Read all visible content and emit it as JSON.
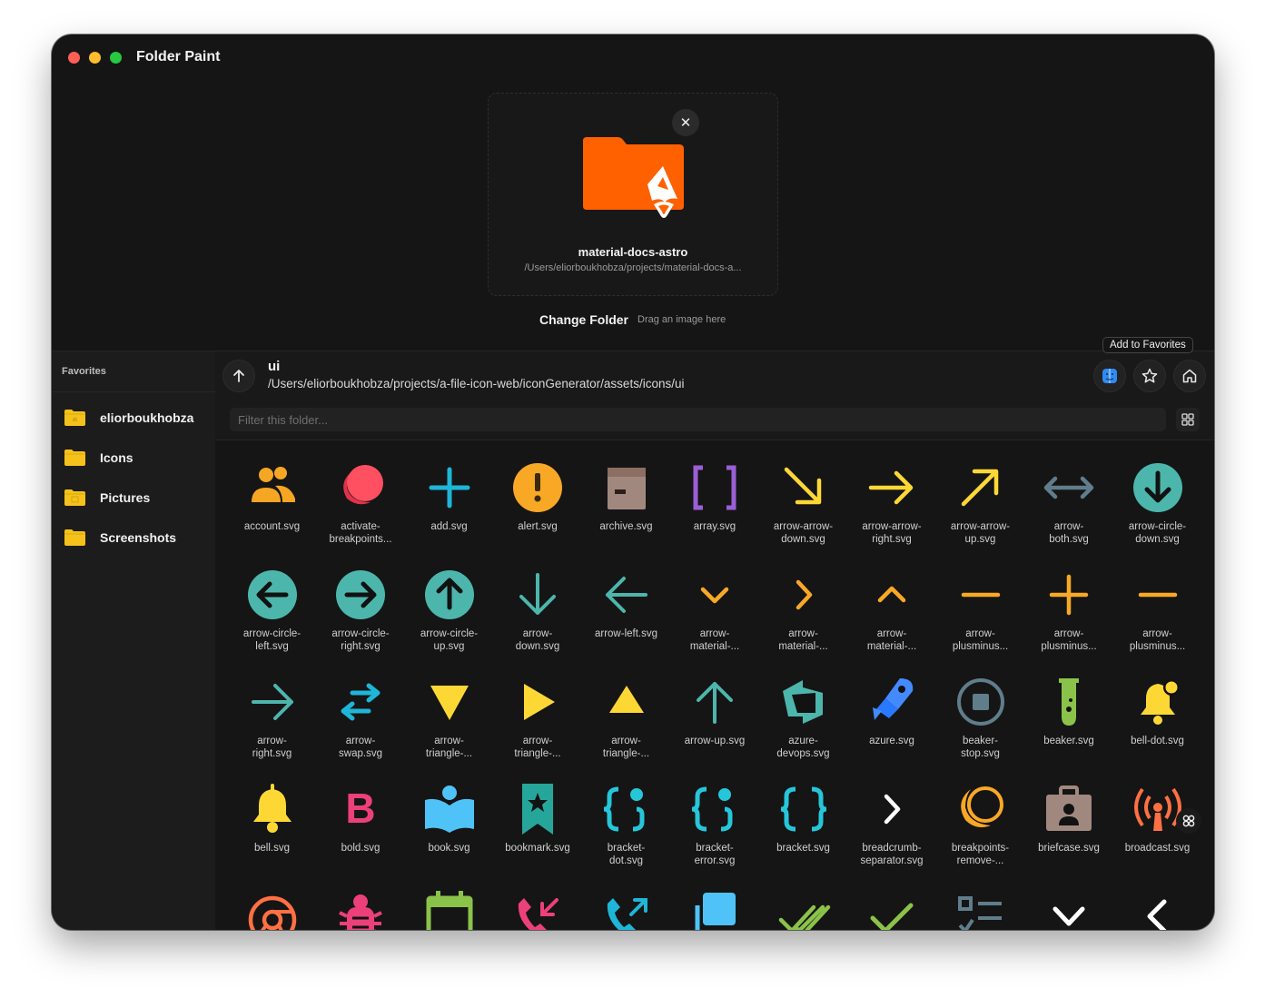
{
  "app": {
    "title": "Folder Paint"
  },
  "dropzone": {
    "folder_name": "material-docs-astro",
    "folder_path": "/Users/eliorboukhobza/projects/material-docs-a...",
    "close_icon": "close-icon"
  },
  "actions": {
    "change_folder": "Change Folder",
    "drag_hint": "Drag an image here"
  },
  "sidebar": {
    "title": "Favorites",
    "items": [
      {
        "label": "eliorboukhobza",
        "icon": "home-folder-icon"
      },
      {
        "label": "Icons",
        "icon": "folder-icon"
      },
      {
        "label": "Pictures",
        "icon": "pictures-folder-icon"
      },
      {
        "label": "Screenshots",
        "icon": "folder-icon"
      }
    ]
  },
  "browser": {
    "dir_name": "ui",
    "dir_path": "/Users/eliorboukhobza/projects/a-file-icon-web/iconGenerator/assets/icons/ui",
    "tooltip": "Add to Favorites",
    "filter_placeholder": "Filter this folder...",
    "filter_value": ""
  },
  "colors": {
    "folder_orange": "#ff6000",
    "window_bg": "#151515",
    "sidebar_bg": "#1c1c1c"
  },
  "icons": [
    {
      "label": "account.svg",
      "icon": "account-icon"
    },
    {
      "label": "activate-\nbreakpoints...",
      "icon": "activate-breakpoints-icon"
    },
    {
      "label": "add.svg",
      "icon": "add-icon"
    },
    {
      "label": "alert.svg",
      "icon": "alert-icon"
    },
    {
      "label": "archive.svg",
      "icon": "archive-icon"
    },
    {
      "label": "array.svg",
      "icon": "array-icon"
    },
    {
      "label": "arrow-arrow-\ndown.svg",
      "icon": "arrow-arrow-down-icon"
    },
    {
      "label": "arrow-arrow-\nright.svg",
      "icon": "arrow-arrow-right-icon"
    },
    {
      "label": "arrow-arrow-\nup.svg",
      "icon": "arrow-arrow-up-icon"
    },
    {
      "label": "arrow-\nboth.svg",
      "icon": "arrow-both-icon"
    },
    {
      "label": "arrow-circle-\ndown.svg",
      "icon": "arrow-circle-down-icon"
    },
    {
      "label": "arrow-circle-\nleft.svg",
      "icon": "arrow-circle-left-icon"
    },
    {
      "label": "arrow-circle-\nright.svg",
      "icon": "arrow-circle-right-icon"
    },
    {
      "label": "arrow-circle-\nup.svg",
      "icon": "arrow-circle-up-icon"
    },
    {
      "label": "arrow-\ndown.svg",
      "icon": "arrow-down-icon"
    },
    {
      "label": "arrow-left.svg",
      "icon": "arrow-left-icon"
    },
    {
      "label": "arrow-\nmaterial-...",
      "icon": "arrow-material-down-icon"
    },
    {
      "label": "arrow-\nmaterial-...",
      "icon": "arrow-material-right-icon"
    },
    {
      "label": "arrow-\nmaterial-...",
      "icon": "arrow-material-up-icon"
    },
    {
      "label": "arrow-\nplusminus...",
      "icon": "arrow-plusminus-minus-icon"
    },
    {
      "label": "arrow-\nplusminus...",
      "icon": "arrow-plusminus-plus-icon"
    },
    {
      "label": "arrow-\nplusminus...",
      "icon": "arrow-plusminus-minus-2-icon"
    },
    {
      "label": "arrow-\nright.svg",
      "icon": "arrow-right-icon"
    },
    {
      "label": "arrow-\nswap.svg",
      "icon": "arrow-swap-icon"
    },
    {
      "label": "arrow-\ntriangle-...",
      "icon": "arrow-triangle-down-icon"
    },
    {
      "label": "arrow-\ntriangle-...",
      "icon": "arrow-triangle-right-icon"
    },
    {
      "label": "arrow-\ntriangle-...",
      "icon": "arrow-triangle-up-icon"
    },
    {
      "label": "arrow-up.svg",
      "icon": "arrow-up-icon"
    },
    {
      "label": "azure-\ndevops.svg",
      "icon": "azure-devops-icon"
    },
    {
      "label": "azure.svg",
      "icon": "azure-icon"
    },
    {
      "label": "beaker-\nstop.svg",
      "icon": "beaker-stop-icon"
    },
    {
      "label": "beaker.svg",
      "icon": "beaker-icon"
    },
    {
      "label": "bell-dot.svg",
      "icon": "bell-dot-icon"
    },
    {
      "label": "bell.svg",
      "icon": "bell-icon"
    },
    {
      "label": "bold.svg",
      "icon": "bold-icon"
    },
    {
      "label": "book.svg",
      "icon": "book-icon"
    },
    {
      "label": "bookmark.svg",
      "icon": "bookmark-icon"
    },
    {
      "label": "bracket-\ndot.svg",
      "icon": "bracket-dot-icon"
    },
    {
      "label": "bracket-\nerror.svg",
      "icon": "bracket-error-icon"
    },
    {
      "label": "bracket.svg",
      "icon": "bracket-icon"
    },
    {
      "label": "breadcrumb-\nseparator.svg",
      "icon": "breadcrumb-separator-icon"
    },
    {
      "label": "breakpoints-\nremove-...",
      "icon": "breakpoints-remove-icon"
    },
    {
      "label": "briefcase.svg",
      "icon": "briefcase-icon"
    },
    {
      "label": "broadcast.svg",
      "icon": "broadcast-icon"
    },
    {
      "label": "",
      "icon": "browser-icon"
    },
    {
      "label": "",
      "icon": "bug-icon"
    },
    {
      "label": "",
      "icon": "calendar-icon"
    },
    {
      "label": "",
      "icon": "call-incoming-icon"
    },
    {
      "label": "",
      "icon": "call-outgoing-icon"
    },
    {
      "label": "",
      "icon": "case-sensitive-icon"
    },
    {
      "label": "",
      "icon": "check-all-icon"
    },
    {
      "label": "",
      "icon": "check-icon"
    },
    {
      "label": "",
      "icon": "checklist-icon"
    },
    {
      "label": "",
      "icon": "chevron-down-icon"
    },
    {
      "label": "",
      "icon": "chevron-left-icon"
    }
  ]
}
